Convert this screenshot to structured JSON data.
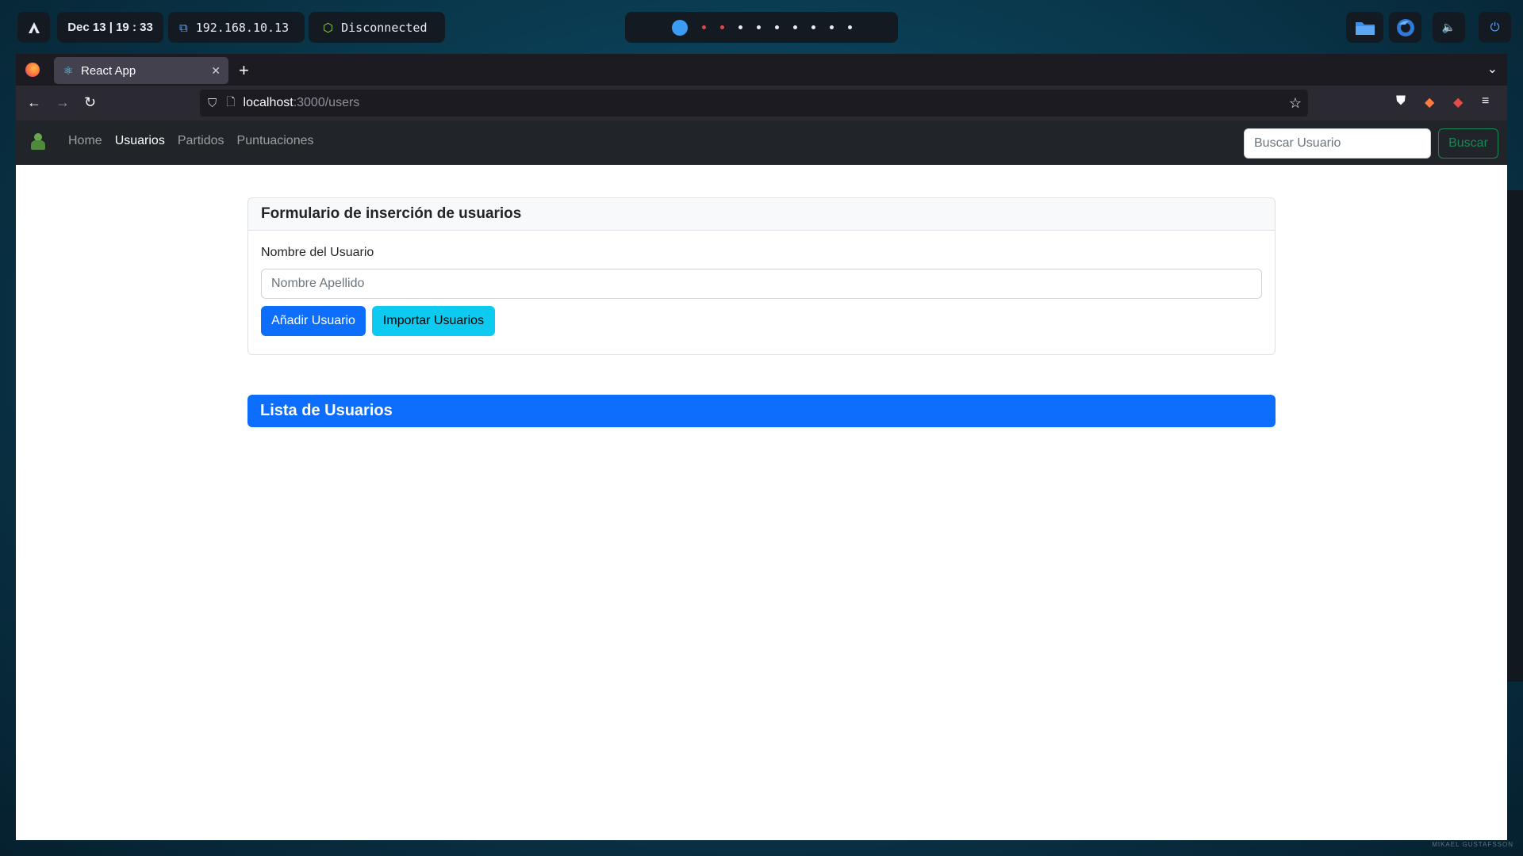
{
  "system_bar": {
    "logo_icon": "arch-logo-icon",
    "clock": "Dec 13  |  19 : 33",
    "ip": "192.168.10.13",
    "vpn_status": "Disconnected",
    "workspaces": [
      "active",
      "red",
      "red",
      "idle",
      "idle",
      "idle",
      "idle",
      "idle",
      "idle",
      "idle"
    ]
  },
  "browser": {
    "tab_title": "React App",
    "url_host": "localhost",
    "url_path": ":3000/users"
  },
  "app": {
    "nav": {
      "links": [
        {
          "label": "Home",
          "active": false
        },
        {
          "label": "Usuarios",
          "active": true
        },
        {
          "label": "Partidos",
          "active": false
        },
        {
          "label": "Puntuaciones",
          "active": false
        }
      ],
      "search_placeholder": "Buscar Usuario",
      "search_button": "Buscar"
    },
    "form_card": {
      "title": "Formulario de inserción de usuarios",
      "name_label": "Nombre del Usuario",
      "name_placeholder": "Nombre Apellido",
      "add_button": "Añadir Usuario",
      "import_button": "Importar Usuarios"
    },
    "list_card": {
      "title": "Lista de Usuarios"
    }
  },
  "wallpaper_credit": "MIKAEL GUSTAFSSON",
  "colors": {
    "primary": "#0d6efd",
    "info": "#0dcaf0",
    "success": "#198754",
    "navbar": "#212529"
  }
}
